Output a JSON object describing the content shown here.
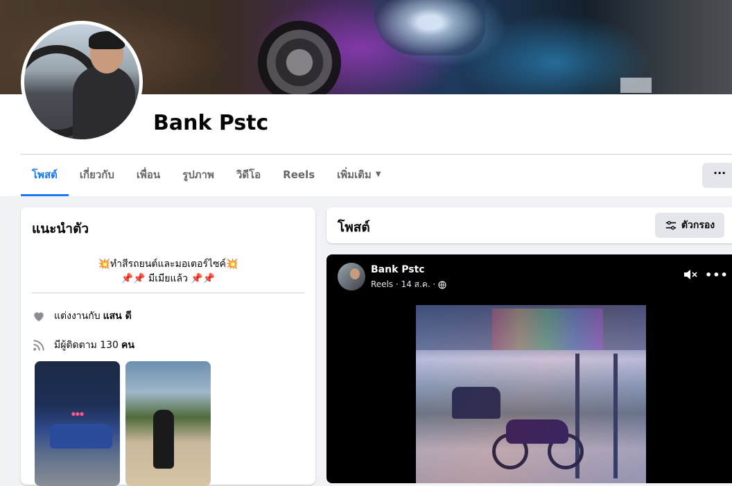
{
  "profile": {
    "name": "Bank Pstc"
  },
  "tabs": [
    {
      "label": "โพสต์",
      "active": true
    },
    {
      "label": "เกี่ยวกับ"
    },
    {
      "label": "เพื่อน"
    },
    {
      "label": "รูปภาพ"
    },
    {
      "label": "วิดีโอ"
    },
    {
      "label": "Reels"
    },
    {
      "label": "เพิ่มเติม",
      "has_caret": true
    }
  ],
  "more_button_label": "···",
  "intro": {
    "title": "แนะนำตัว",
    "bio_line1": "💥ทำสีรถยนต์และมอเตอร์ไซค์💥",
    "bio_line2": "📌📌 มีเมียแล้ว 📌📌",
    "relationship_prefix": "แต่งงานกับ",
    "relationship_name": "แสน ดี",
    "followers_prefix": "มีผู้ติดตาม 130",
    "followers_suffix": "คน"
  },
  "posts_header": {
    "title": "โพสต์",
    "filter_label": "ตัวกรอง"
  },
  "reel_post": {
    "author": "Bank Pstc",
    "meta": "Reels · 14 ส.ค. ·"
  },
  "colors": {
    "accent": "#1877f2",
    "background": "#f0f2f5",
    "button_gray": "#e4e6eb"
  }
}
